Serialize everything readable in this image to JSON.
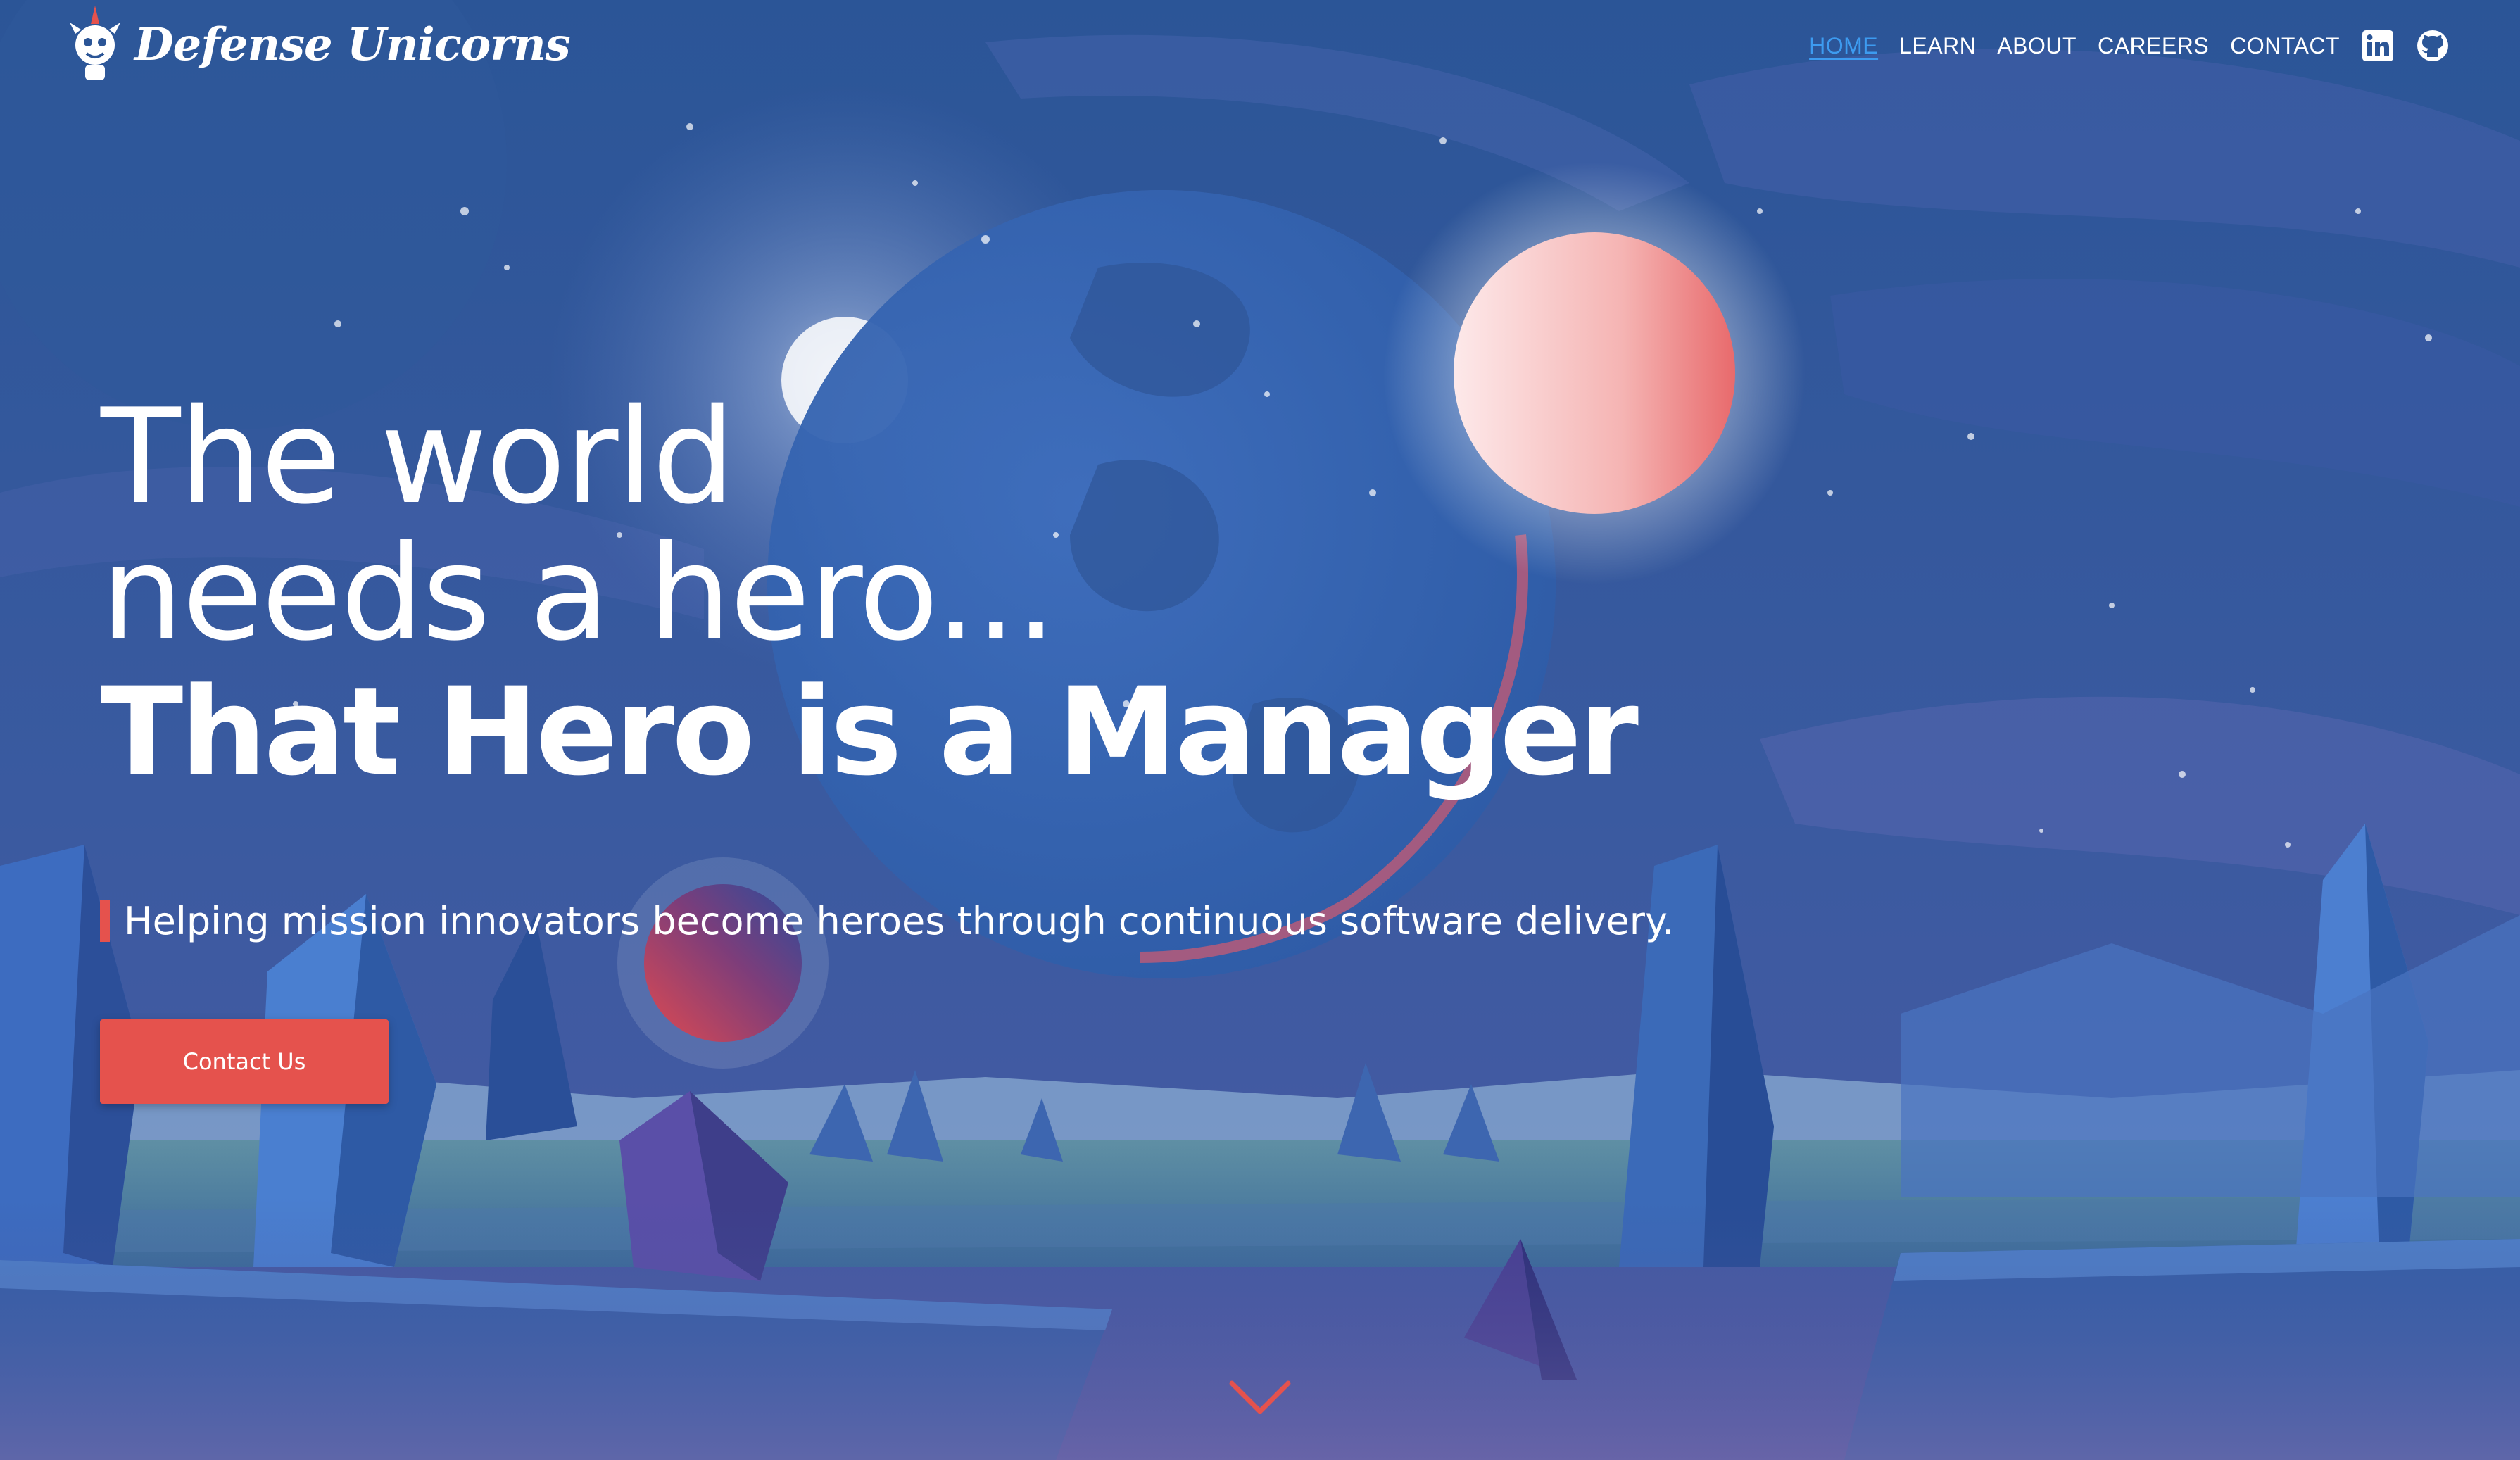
{
  "brand": {
    "name": "Defense Unicorns",
    "logo_icon": "unicorn-mascot-icon"
  },
  "nav": {
    "items": [
      {
        "label": "HOME",
        "active": true
      },
      {
        "label": "LEARN",
        "active": false
      },
      {
        "label": "ABOUT",
        "active": false
      },
      {
        "label": "CAREERS",
        "active": false
      },
      {
        "label": "CONTACT",
        "active": false
      }
    ],
    "icons": [
      "linkedin-icon",
      "github-icon"
    ]
  },
  "hero": {
    "line1": "The world",
    "line2": "needs a hero...",
    "line3": "That Hero is a Manager",
    "tagline": "Helping mission innovators become heroes through continuous software delivery.",
    "cta_label": "Contact Us",
    "scroll_icon": "chevron-down-icon"
  },
  "colors": {
    "accent": "#e5524d",
    "active_nav": "#3d9bf0",
    "background": "#2b5596",
    "text": "#ffffff"
  }
}
